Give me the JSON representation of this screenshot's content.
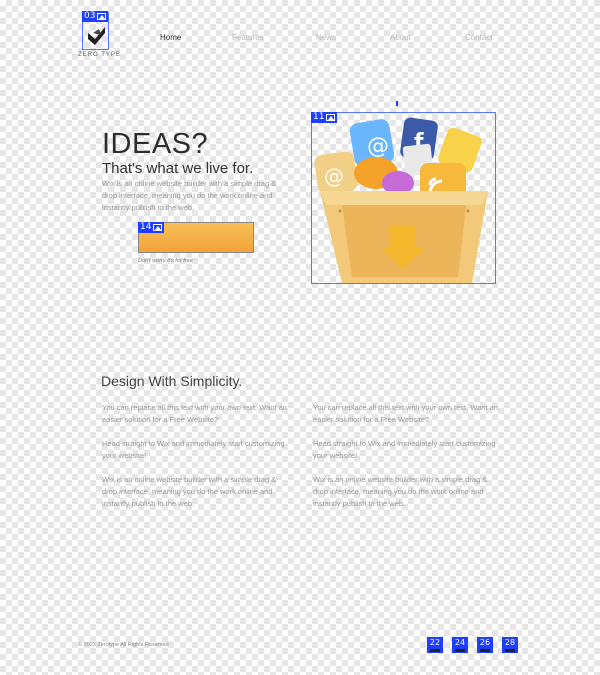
{
  "editor_markers": {
    "logo": "03",
    "cta": "14",
    "hero_image": "11",
    "social": [
      "22",
      "24",
      "26",
      "28"
    ]
  },
  "logo": {
    "text": "ZERO TYPE"
  },
  "nav": {
    "items": [
      "Home",
      "Features",
      "News",
      "About",
      "Contact"
    ]
  },
  "hero": {
    "title": "IDEAS?",
    "subtitle": "That's what we live for.",
    "body": "Wix is an online website builder with a simple drag & drop interface, meaning you do the work online and instantly publish to the web.",
    "cta_caption": "Don't worry it's for free"
  },
  "features": {
    "title": "Design With Simplicity.",
    "left": [
      "You can replace all this text with your own text. Want an easier solution for a Free Website?",
      "Head straight to Wix and immediately start customizing your website!",
      "Wix is an online website builder with a simple drag & drop interface, meaning you do the work online and instantly publish to the web."
    ],
    "right": [
      "You can replace all this text with your own text. Want an easier solution for a Free Website?",
      "Head straight to Wix and immediately start customizing your website!",
      "Wix is an online website builder with a simple drag & drop interface, meaning you do the work online and instantly publish to the web."
    ]
  },
  "footer": {
    "text": "© 2023 Zerotype All Rights Reserved"
  },
  "colors": {
    "accent_orange": "#f3a33a",
    "editor_blue": "#1e3fff"
  }
}
